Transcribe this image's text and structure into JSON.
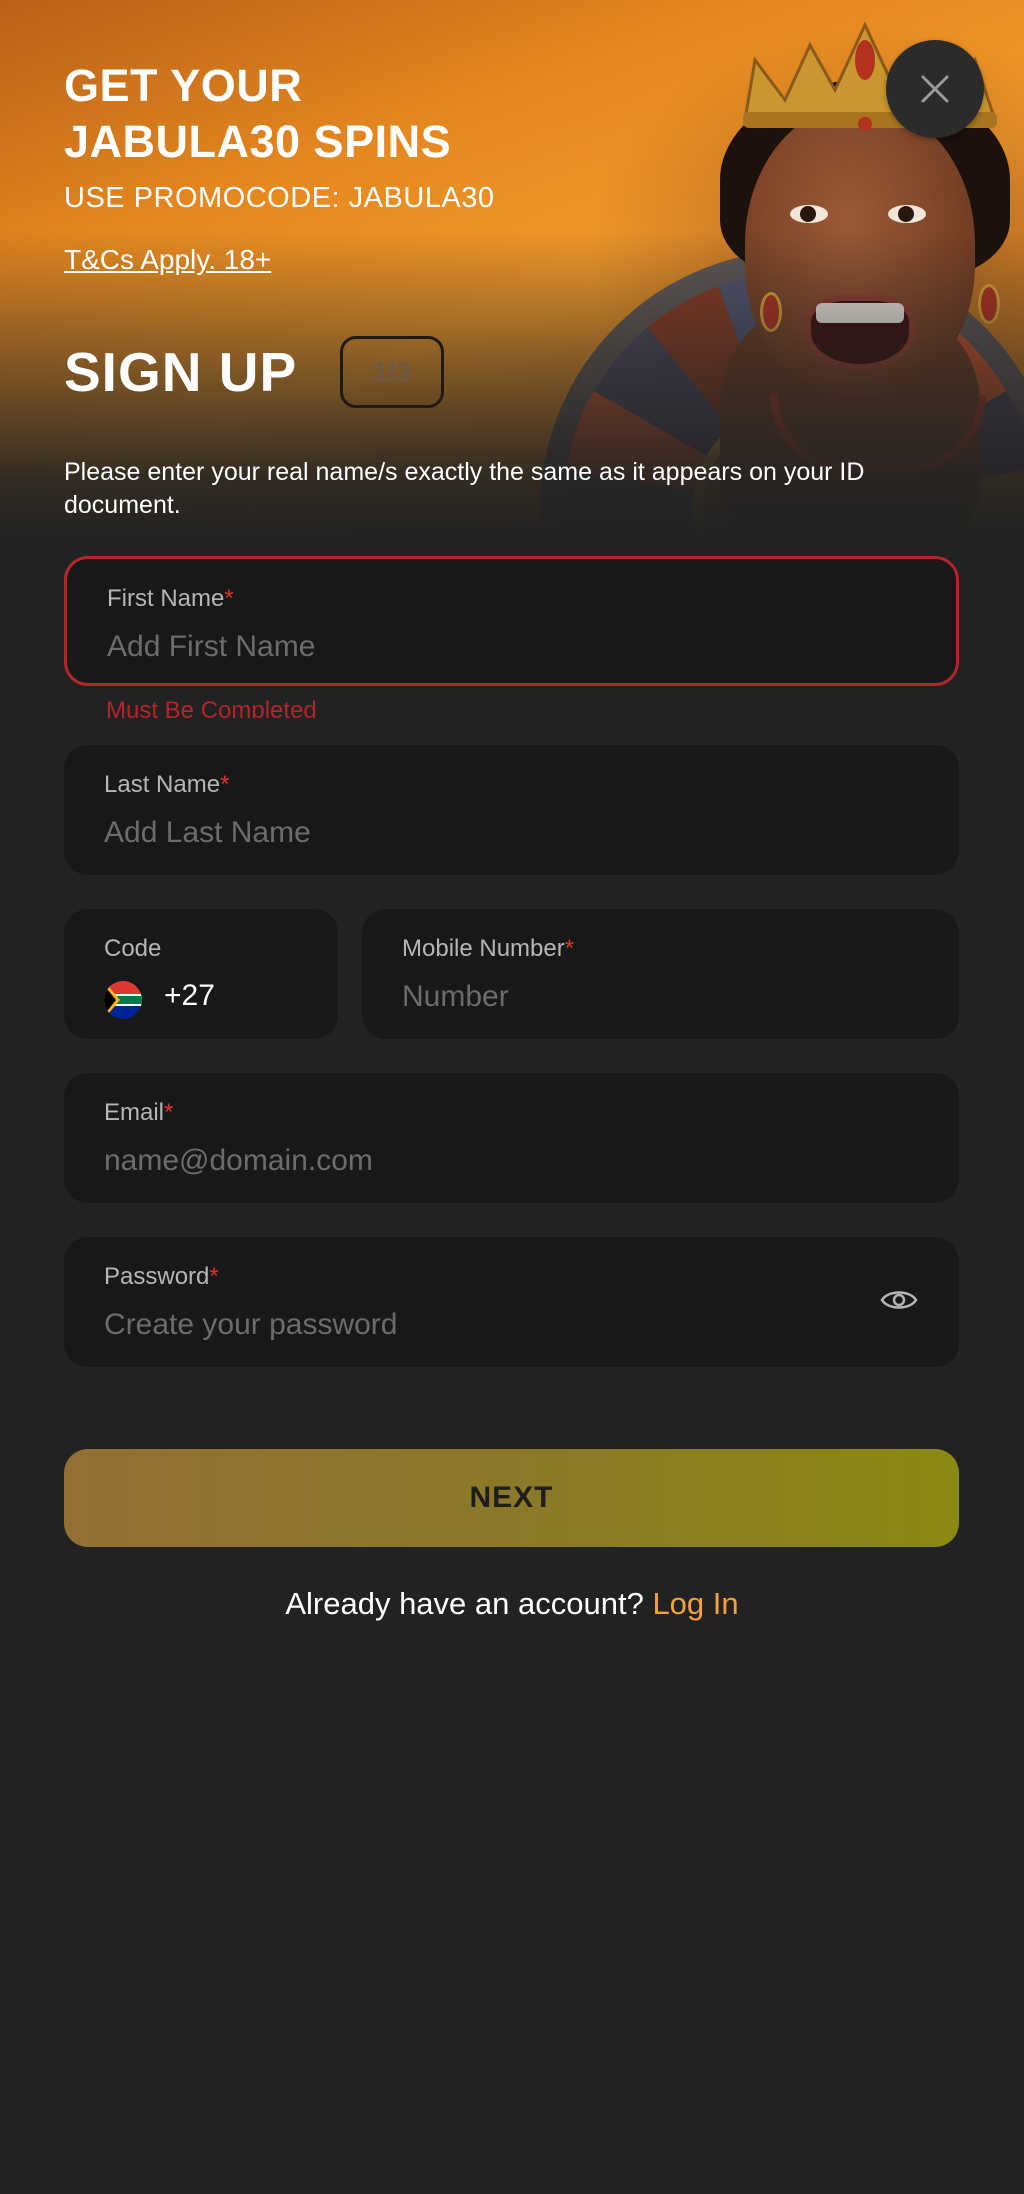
{
  "promo": {
    "title_line1": "GET YOUR",
    "title_line2": "JABULA30 SPINS",
    "subtitle": "USE PROMOCODE: JABULA30",
    "terms": "T&Cs Apply. 18+"
  },
  "signup": {
    "heading": "SIGN UP",
    "step": "1/3",
    "intro": "Please enter your real name/s exactly the same as it appears on your ID document."
  },
  "form": {
    "first_name": {
      "label": "First Name",
      "required": "*",
      "placeholder": "Add First Name",
      "error": "Must Be Completed"
    },
    "last_name": {
      "label": "Last Name",
      "required": "*",
      "placeholder": "Add Last Name"
    },
    "code": {
      "label": "Code",
      "value": "+27"
    },
    "mobile": {
      "label": "Mobile Number",
      "required": "*",
      "placeholder": "Number"
    },
    "email": {
      "label": "Email",
      "required": "*",
      "placeholder": "name@domain.com"
    },
    "password": {
      "label": "Password",
      "required": "*",
      "placeholder": "Create your password"
    }
  },
  "actions": {
    "next": "NEXT",
    "login_prompt": "Already have an account?",
    "login_link": "Log In"
  },
  "icons": {
    "close": "close-icon",
    "flag": "south-africa-flag-icon",
    "eye": "eye-icon"
  },
  "colors": {
    "background": "#222222",
    "field_background": "#181818",
    "error": "#b3262a",
    "required": "#e0302f",
    "link": "#f2a23a",
    "button_start": "#936f33",
    "button_end": "#8a8a12"
  }
}
